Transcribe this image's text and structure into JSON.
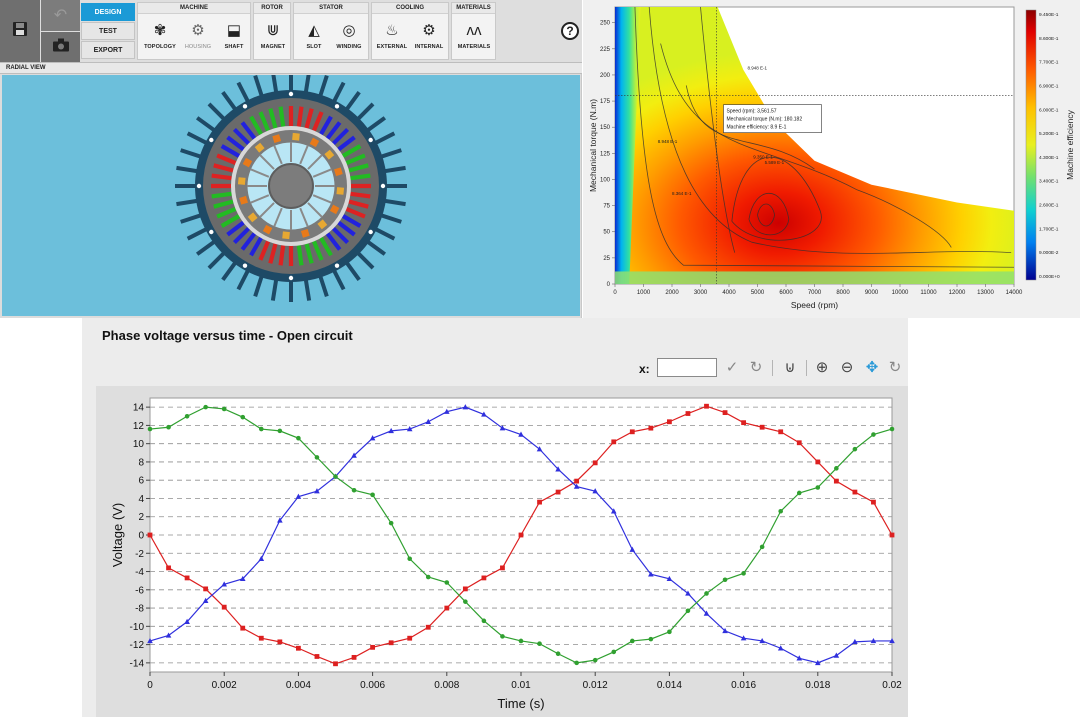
{
  "toolbar": {
    "tabs": [
      {
        "label": "DESIGN",
        "active": true
      },
      {
        "label": "TEST",
        "active": false
      },
      {
        "label": "EXPORT",
        "active": false
      }
    ],
    "groups": [
      {
        "title": "MACHINE",
        "tools": [
          {
            "label": "TOPOLOGY",
            "icon": "topology-icon",
            "enabled": true
          },
          {
            "label": "HOUSING",
            "icon": "housing-icon",
            "enabled": false
          },
          {
            "label": "SHAFT",
            "icon": "shaft-icon",
            "enabled": true
          }
        ]
      },
      {
        "title": "ROTOR",
        "tools": [
          {
            "label": "MAGNET",
            "icon": "magnet-icon",
            "enabled": true
          }
        ]
      },
      {
        "title": "STATOR",
        "tools": [
          {
            "label": "SLOT",
            "icon": "slot-icon",
            "enabled": true
          },
          {
            "label": "WINDING",
            "icon": "winding-icon",
            "enabled": true
          }
        ]
      },
      {
        "title": "COOLING",
        "tools": [
          {
            "label": "EXTERNAL",
            "icon": "external-cooling-icon",
            "enabled": true
          },
          {
            "label": "INTERNAL",
            "icon": "internal-cooling-icon",
            "enabled": true
          }
        ]
      },
      {
        "title": "MATERIALS",
        "tools": [
          {
            "label": "MATERIALS",
            "icon": "materials-icon",
            "enabled": true
          }
        ]
      }
    ],
    "help_label": "?"
  },
  "radial_view": {
    "label": "RADIAL VIEW",
    "background": "#6cbfdb"
  },
  "efficiency_map": {
    "xlabel": "Speed (rpm)",
    "ylabel": "Mechanical torque (N.m)",
    "colorbar_label": "Machine efficiency",
    "x_ticks": [
      "0",
      "1000",
      "2000",
      "3000",
      "4000",
      "5000",
      "6000",
      "7000",
      "8000",
      "9000",
      "10000",
      "11000",
      "12000",
      "13000",
      "14000"
    ],
    "y_ticks": [
      "0",
      "25",
      "50",
      "75",
      "100",
      "125",
      "150",
      "175",
      "200",
      "225",
      "250"
    ],
    "colorbar_ticks": [
      "9.450E-1",
      "8.600E-1",
      "7.700E-1",
      "6.900E-1",
      "6.000E-1",
      "5.200E-1",
      "4.300E-1",
      "3.400E-1",
      "2.600E-1",
      "1.700E-1",
      "9.000E-2",
      "0.000E+0"
    ],
    "contour_labels": [
      "8.948 E-1",
      "8.364 E-1",
      "8.948 E-1",
      "9.286 E-1",
      "9.350 E-1",
      "5.589 E-1"
    ],
    "tooltip": [
      "Speed (rpm): 3,561.57",
      "Mechanical torque (N.m): 180.182",
      "Machine efficiency: 8.9 E-1"
    ],
    "cursor": {
      "speed": 3561.57,
      "torque": 180.182
    }
  },
  "phase_panel": {
    "title": "Phase voltage versus time - Open circuit",
    "x_label": "x:",
    "x_value": "",
    "tools": [
      {
        "name": "apply-check-icon",
        "glyph": "✓"
      },
      {
        "name": "reset-icon",
        "glyph": "↻"
      },
      {
        "name": "magnet-snap-icon",
        "glyph": "⊍"
      },
      {
        "name": "zoom-in-icon",
        "glyph": "⊕"
      },
      {
        "name": "zoom-out-icon",
        "glyph": "⊖"
      },
      {
        "name": "pan-icon",
        "glyph": "✥"
      },
      {
        "name": "reset-view-icon",
        "glyph": "↻"
      }
    ]
  },
  "chart_data": {
    "type": "line",
    "title": "",
    "xlabel": "Time (s)",
    "ylabel": "Voltage (V)",
    "xlim": [
      0,
      0.02
    ],
    "ylim": [
      -15,
      15
    ],
    "x_ticks": [
      0,
      0.002,
      0.004,
      0.006,
      0.008,
      0.01,
      0.012,
      0.014,
      0.016,
      0.018,
      0.02
    ],
    "x_tick_labels": [
      "0",
      "0.002",
      "0.004",
      "0.006",
      "0.008",
      "0.01",
      "0.012",
      "0.014",
      "0.016",
      "0.018",
      "0.02"
    ],
    "y_ticks": [
      -14,
      -12,
      -10,
      -8,
      -6,
      -4,
      -2,
      0,
      2,
      4,
      6,
      8,
      10,
      12,
      14
    ],
    "grid": "horizontal dashed",
    "x": [
      0,
      0.0005,
      0.001,
      0.0015,
      0.002,
      0.0025,
      0.003,
      0.0035,
      0.004,
      0.0045,
      0.005,
      0.0055,
      0.006,
      0.0065,
      0.007,
      0.0075,
      0.008,
      0.0085,
      0.009,
      0.0095,
      0.01,
      0.0105,
      0.011,
      0.0115,
      0.012,
      0.0125,
      0.013,
      0.0135,
      0.014,
      0.0145,
      0.015,
      0.0155,
      0.016,
      0.0165,
      0.017,
      0.0175,
      0.018,
      0.0185,
      0.019,
      0.0195,
      0.02
    ],
    "series": [
      {
        "color": "#dd2020",
        "marker": "square",
        "values": [
          0,
          -3.6,
          -4.7,
          -5.9,
          -7.9,
          -10.2,
          -11.3,
          -11.7,
          -12.4,
          -13.3,
          -14.1,
          -13.4,
          -12.3,
          -11.8,
          -11.3,
          -10.1,
          -8.0,
          -5.9,
          -4.7,
          -3.6,
          0,
          3.6,
          4.7,
          5.9,
          7.9,
          10.2,
          11.3,
          11.7,
          12.4,
          13.3,
          14.1,
          13.4,
          12.3,
          11.8,
          11.3,
          10.1,
          8.0,
          5.9,
          4.7,
          3.6,
          0
        ]
      },
      {
        "color": "#3030dd",
        "marker": "triangle",
        "values": [
          -11.6,
          -11.0,
          -9.5,
          -7.2,
          -5.4,
          -4.8,
          -2.6,
          1.6,
          4.2,
          4.8,
          6.4,
          8.7,
          10.6,
          11.4,
          11.6,
          12.4,
          13.5,
          14.0,
          13.2,
          11.7,
          11.0,
          9.4,
          7.2,
          5.3,
          4.8,
          2.6,
          -1.6,
          -4.3,
          -4.8,
          -6.4,
          -8.6,
          -10.5,
          -11.3,
          -11.6,
          -12.4,
          -13.5,
          -14.0,
          -13.2,
          -11.7,
          -11.6,
          -11.6
        ]
      },
      {
        "color": "#30a030",
        "marker": "circle",
        "values": [
          11.6,
          11.8,
          13.0,
          14.0,
          13.8,
          12.9,
          11.6,
          11.4,
          10.6,
          8.5,
          6.4,
          4.9,
          4.4,
          1.3,
          -2.6,
          -4.6,
          -5.2,
          -7.3,
          -9.4,
          -11.1,
          -11.6,
          -11.9,
          -13.0,
          -14.0,
          -13.7,
          -12.8,
          -11.6,
          -11.4,
          -10.6,
          -8.3,
          -6.4,
          -4.9,
          -4.2,
          -1.3,
          2.6,
          4.6,
          5.2,
          7.3,
          9.4,
          11.0,
          11.6
        ]
      }
    ]
  }
}
